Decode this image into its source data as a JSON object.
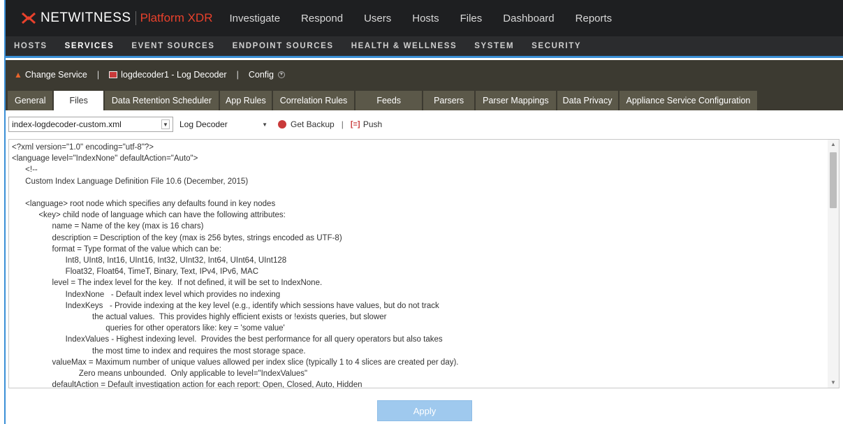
{
  "app": {
    "brand": "NETWITNESS",
    "product": "Platform XDR"
  },
  "topnav": [
    "Investigate",
    "Respond",
    "Users",
    "Hosts",
    "Files",
    "Dashboard",
    "Reports"
  ],
  "subnav": {
    "items": [
      "HOSTS",
      "SERVICES",
      "EVENT SOURCES",
      "ENDPOINT SOURCES",
      "HEALTH & WELLNESS",
      "SYSTEM",
      "SECURITY"
    ],
    "active": "SERVICES"
  },
  "servicebar": {
    "change_service": "Change Service",
    "service_name": "logdecoder1 - Log Decoder",
    "config": "Config"
  },
  "tabs": {
    "items": [
      "General",
      "Files",
      "Data Retention Scheduler",
      "App Rules",
      "Correlation Rules",
      "Feeds",
      "Parsers",
      "Parser Mappings",
      "Data Privacy",
      "Appliance Service Configuration"
    ],
    "active": "Files"
  },
  "toolbar": {
    "file_select": "index-logdecoder-custom.xml",
    "service_select": "Log Decoder",
    "get_backup": "Get Backup",
    "push": "Push"
  },
  "editor": {
    "lines": [
      "<?xml version=\"1.0\" encoding=\"utf-8\"?>",
      "<language level=\"IndexNone\" defaultAction=\"Auto\">",
      "      <!--",
      "      Custom Index Language Definition File 10.6 (December, 2015)",
      "",
      "      <language> root node which specifies any defaults found in key nodes",
      "            <key> child node of language which can have the following attributes:",
      "                  name = Name of the key (max is 16 chars)",
      "                  description = Description of the key (max is 256 bytes, strings encoded as UTF-8)",
      "                  format = Type format of the value which can be:",
      "                        Int8, UInt8, Int16, UInt16, Int32, UInt32, Int64, UInt64, UInt128",
      "                        Float32, Float64, TimeT, Binary, Text, IPv4, IPv6, MAC",
      "                  level = The index level for the key.  If not defined, it will be set to IndexNone.",
      "                        IndexNone   - Default index level which provides no indexing",
      "                        IndexKeys   - Provide indexing at the key level (e.g., identify which sessions have values, but do not track",
      "                                    the actual values.  This provides highly efficient exists or !exists queries, but slower",
      "                                          queries for other operators like: key = 'some value'",
      "                        IndexValues - Highest indexing level.  Provides the best performance for all query operators but also takes",
      "                                    the most time to index and requires the most storage space.",
      "                  valueMax = Maximum number of unique values allowed per index slice (typically 1 to 4 slices are created per day).",
      "                              Zero means unbounded.  Only applicable to level=\"IndexValues\"",
      "                  defaultAction = Default investigation action for each report: Open, Closed, Auto, Hidden"
    ]
  },
  "apply_label": "Apply",
  "colors": {
    "topbar": "#1e1f21",
    "accent": "#3a8fd6",
    "brand_red": "#e8412c",
    "servicebar": "#3c3a31"
  }
}
